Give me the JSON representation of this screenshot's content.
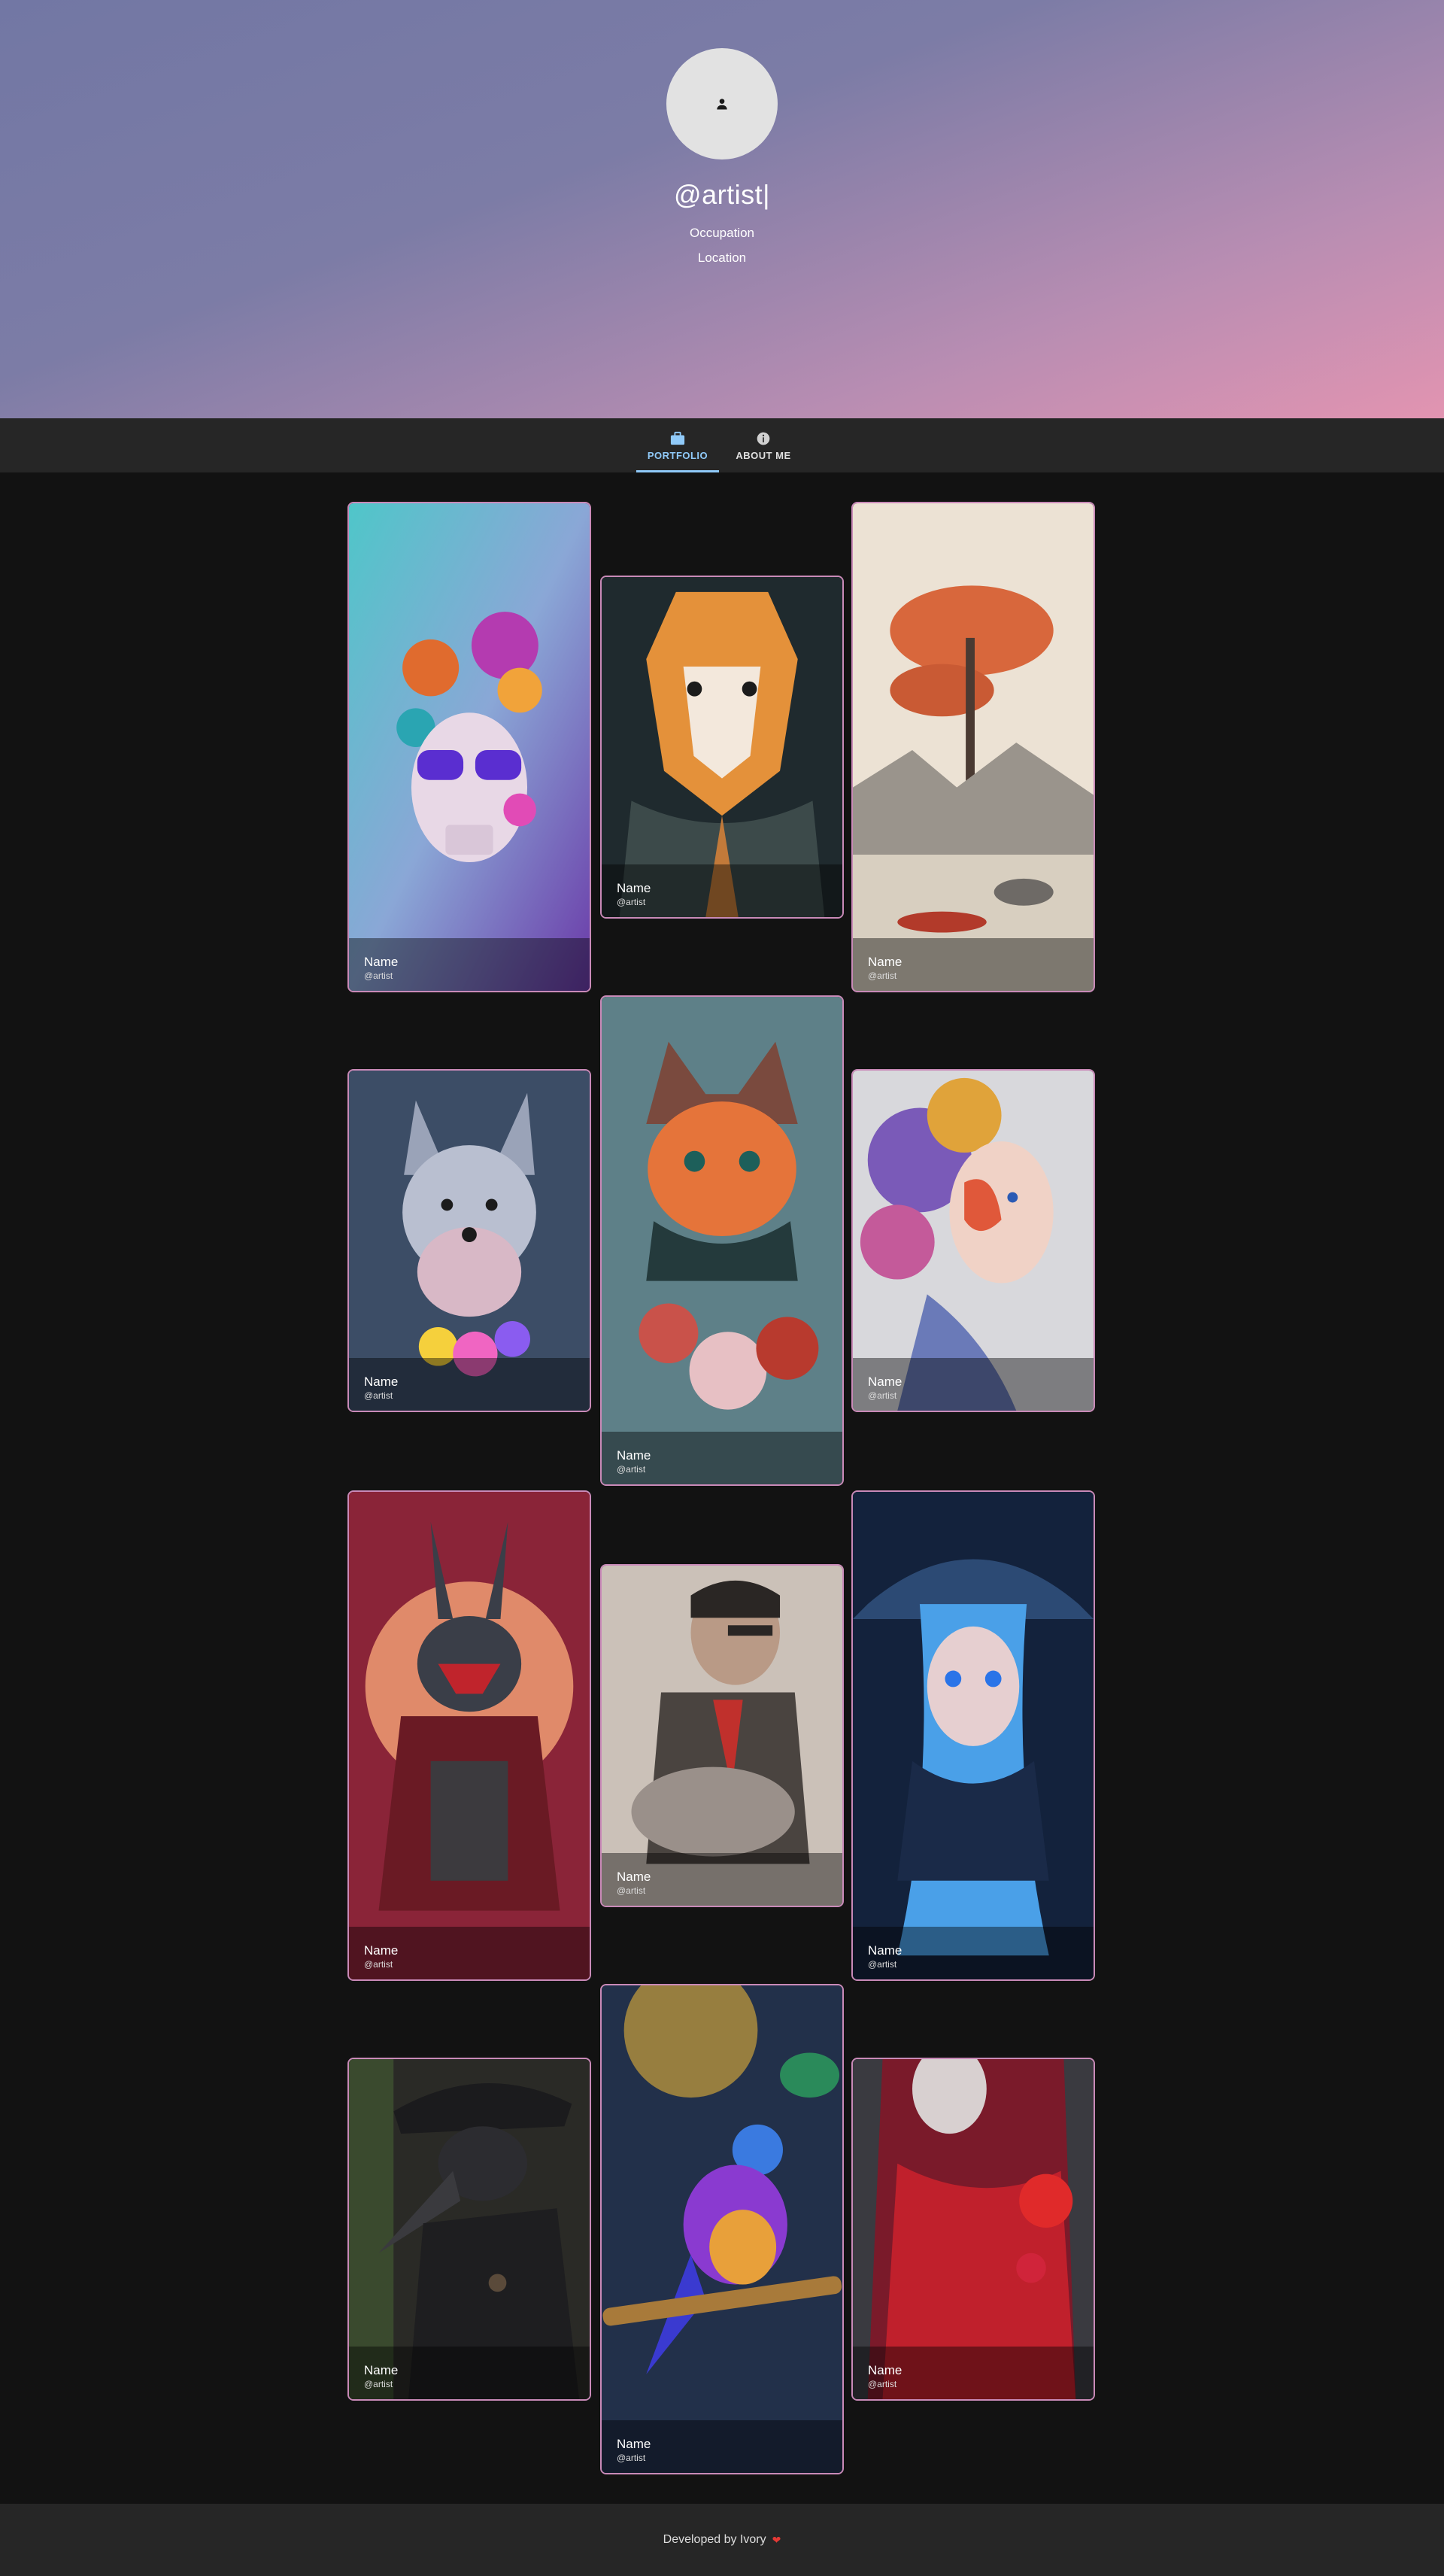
{
  "profile": {
    "handle": "@artist|",
    "occupation": "Occupation",
    "location": "Location",
    "avatar_icon": "person-icon"
  },
  "tabs": [
    {
      "label": "PORTFOLIO",
      "icon": "briefcase-icon",
      "active": true,
      "color": "#90caf9"
    },
    {
      "label": "ABOUT ME",
      "icon": "info-icon",
      "active": false,
      "color": "#e0e0e0"
    }
  ],
  "gallery": [
    {
      "name": "Name",
      "user": "@artist",
      "art": "floral-skull-with-sunglasses"
    },
    {
      "name": "Name",
      "user": "@artist",
      "art": "tiger-portrait"
    },
    {
      "name": "Name",
      "user": "@artist",
      "art": "red-tree-landscape"
    },
    {
      "name": "Name",
      "user": "@artist",
      "art": "colorful-terrier-dog"
    },
    {
      "name": "Name",
      "user": "@artist",
      "art": "hooded-cat-with-flowers"
    },
    {
      "name": "Name",
      "user": "@artist",
      "art": "painted-woman-portrait"
    },
    {
      "name": "Name",
      "user": "@artist",
      "art": "samurai-rabbit"
    },
    {
      "name": "Name",
      "user": "@artist",
      "art": "smoky-man-with-glasses"
    },
    {
      "name": "Name",
      "user": "@artist",
      "art": "blue-haired-witch-girl"
    },
    {
      "name": "Name",
      "user": "@artist",
      "art": "plague-doctor"
    },
    {
      "name": "Name",
      "user": "@artist",
      "art": "colorful-bird-on-branch"
    },
    {
      "name": "Name",
      "user": "@artist",
      "art": "red-hooded-skull-woman"
    }
  ],
  "footer": {
    "text": "Developed by Ivory",
    "icon": "heart-icon"
  },
  "colors": {
    "accent": "#90caf9",
    "card_border": "#c98ab8",
    "background": "#121212",
    "bar": "#262626"
  }
}
